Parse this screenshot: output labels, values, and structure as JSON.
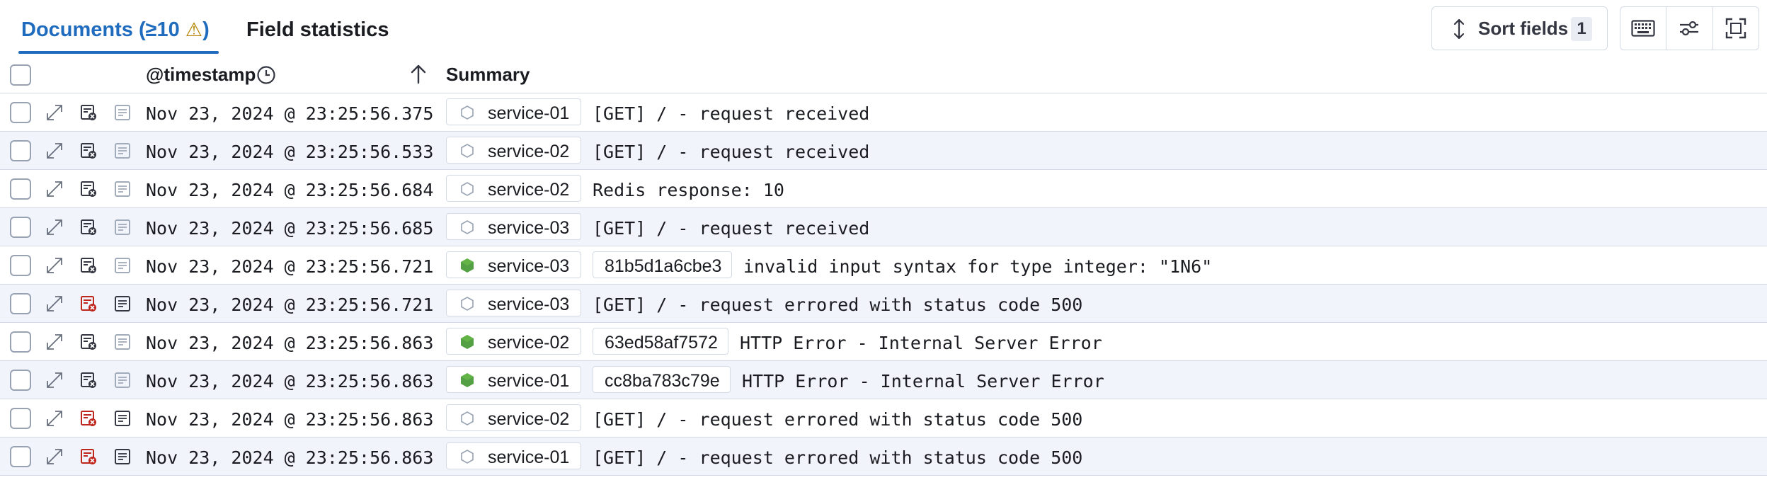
{
  "tabs": {
    "documents_label": "Documents (≥10 ",
    "documents_warn": "⚠",
    "documents_close": ")",
    "field_statistics_label": "Field statistics"
  },
  "toolbar": {
    "sort_fields_label": "Sort fields",
    "sort_fields_count": "1"
  },
  "grid": {
    "header": {
      "timestamp_label": "@timestamp",
      "summary_label": "Summary"
    },
    "rows": [
      {
        "timestamp": "Nov 23, 2024 @ 23:25:56.375",
        "service": "service-01",
        "service_icon": "hexagon-outline",
        "trace_id": "",
        "message": "[GET] / - request received",
        "degraded": false
      },
      {
        "timestamp": "Nov 23, 2024 @ 23:25:56.533",
        "service": "service-02",
        "service_icon": "hexagon-outline",
        "trace_id": "",
        "message": "[GET] / - request received",
        "degraded": false
      },
      {
        "timestamp": "Nov 23, 2024 @ 23:25:56.684",
        "service": "service-02",
        "service_icon": "hexagon-outline",
        "trace_id": "",
        "message": "Redis response: 10",
        "degraded": false
      },
      {
        "timestamp": "Nov 23, 2024 @ 23:25:56.685",
        "service": "service-03",
        "service_icon": "hexagon-outline",
        "trace_id": "",
        "message": "[GET] / - request received",
        "degraded": false
      },
      {
        "timestamp": "Nov 23, 2024 @ 23:25:56.721",
        "service": "service-03",
        "service_icon": "nodejs-hexagon",
        "trace_id": "81b5d1a6cbe3",
        "message": "invalid input syntax for type integer: \"1N6\"",
        "degraded": false
      },
      {
        "timestamp": "Nov 23, 2024 @ 23:25:56.721",
        "service": "service-03",
        "service_icon": "hexagon-outline",
        "trace_id": "",
        "message": "[GET] / - request errored with status code 500",
        "degraded": true
      },
      {
        "timestamp": "Nov 23, 2024 @ 23:25:56.863",
        "service": "service-02",
        "service_icon": "nodejs-hexagon",
        "trace_id": "63ed58af7572",
        "message": "HTTP Error - Internal Server Error",
        "degraded": false
      },
      {
        "timestamp": "Nov 23, 2024 @ 23:25:56.863",
        "service": "service-01",
        "service_icon": "nodejs-hexagon",
        "trace_id": "cc8ba783c79e",
        "message": "HTTP Error - Internal Server Error",
        "degraded": false
      },
      {
        "timestamp": "Nov 23, 2024 @ 23:25:56.863",
        "service": "service-02",
        "service_icon": "hexagon-outline",
        "trace_id": "",
        "message": "[GET] / - request errored with status code 500",
        "degraded": true
      },
      {
        "timestamp": "Nov 23, 2024 @ 23:25:56.863",
        "service": "service-01",
        "service_icon": "hexagon-outline",
        "trace_id": "",
        "message": "[GET] / - request errored with status code 500",
        "degraded": true
      }
    ]
  },
  "colors": {
    "accent": "#1f6bbd",
    "warning": "#b58300",
    "node_green": "#54a044",
    "degraded_red": "#bd271e",
    "row_alt": "#f1f4fa"
  }
}
